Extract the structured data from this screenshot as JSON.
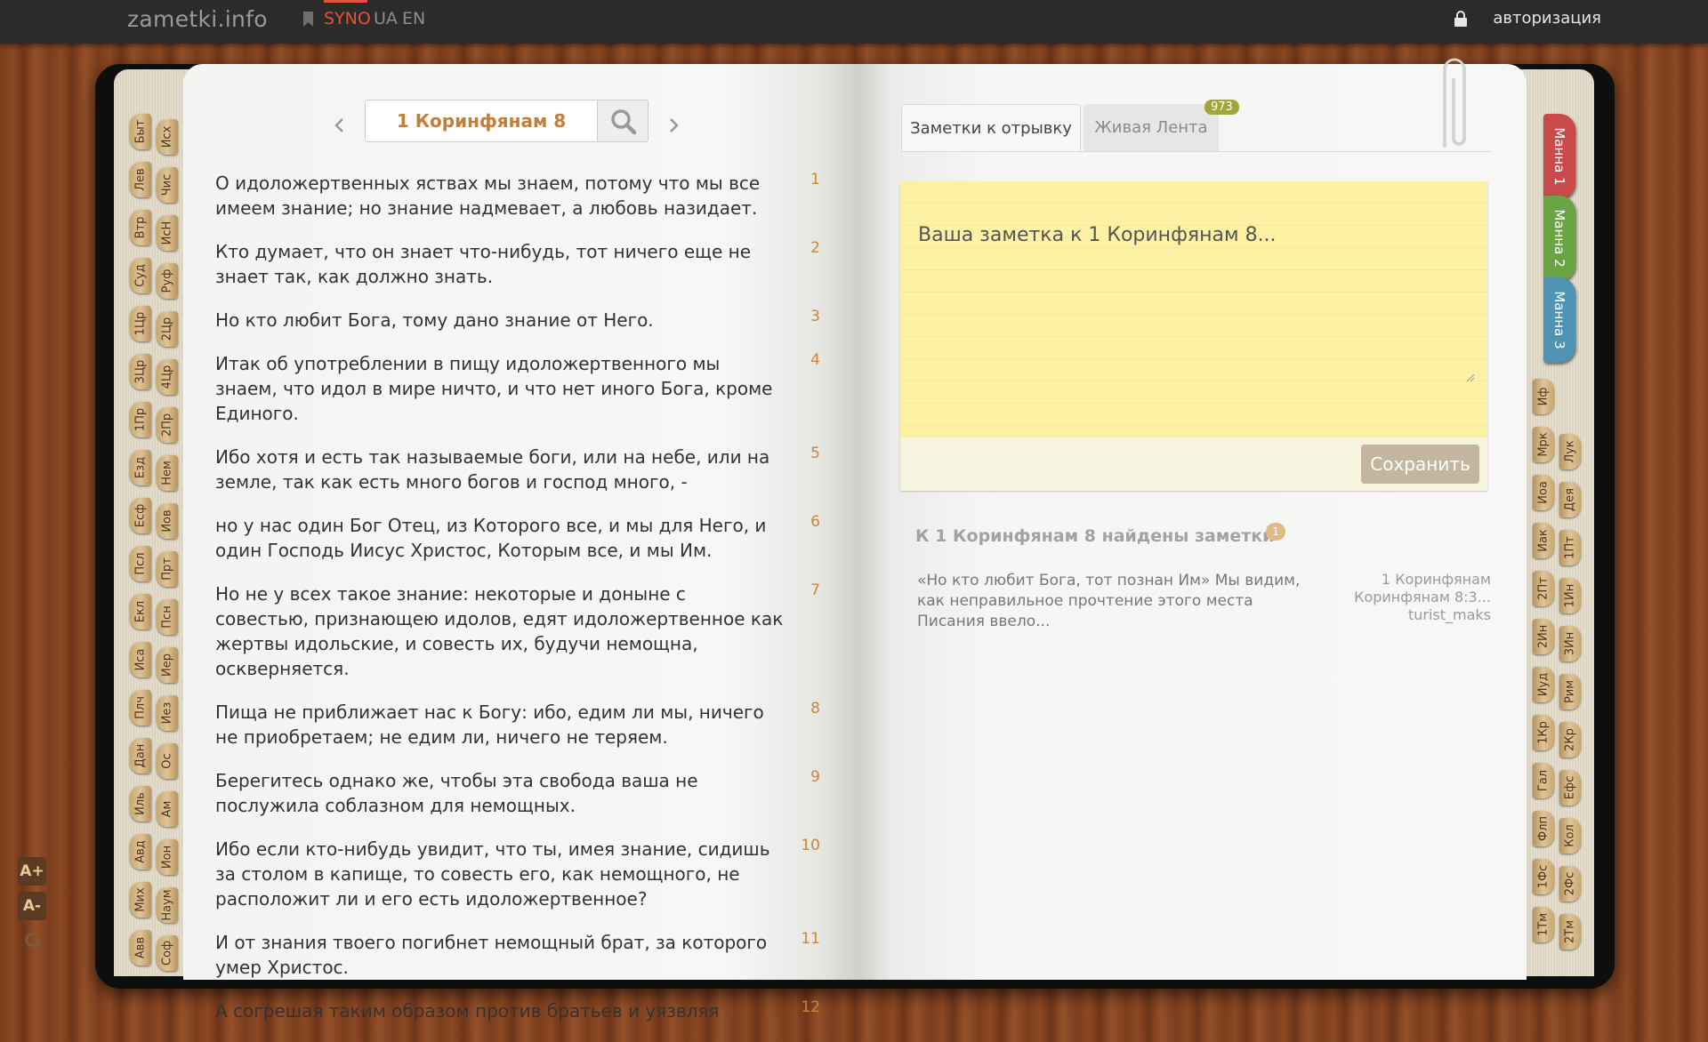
{
  "topbar": {
    "logo": "zametki.info",
    "languages": [
      "SYNO",
      "UA",
      "EN"
    ],
    "active_language": "SYNO",
    "auth_label": "авторизация",
    "accent_color": "#e3503c"
  },
  "left_tabs": {
    "col1": [
      "Быт",
      "Лев",
      "Втр",
      "Суд",
      "1Цр",
      "3Цр",
      "1Пр",
      "Езд",
      "Есф",
      "Псл",
      "Екл",
      "Иса",
      "Плч",
      "Дан",
      "Иль",
      "Авд",
      "Мих",
      "Авв"
    ],
    "col2": [
      "Исх",
      "Чис",
      "ИсН",
      "Руф",
      "2Цр",
      "4Цр",
      "2Пр",
      "Нем",
      "Иов",
      "Прт",
      "Псн",
      "Иер",
      "Иез",
      "Ос",
      "Ам",
      "Ион",
      "Наум",
      "Соф"
    ]
  },
  "right_tabs": {
    "manna": [
      "Манна 1",
      "Манна 2",
      "Манна 3"
    ],
    "col1": [
      "Иф",
      "Мрк",
      "Иоа",
      "Иак",
      "2Пт",
      "2Ин",
      "Иуд",
      "1Кр",
      "Гал",
      "Флп",
      "1Фс",
      "1Тм"
    ],
    "col2": [
      "Лук",
      "Дея",
      "1Пт",
      "1Ин",
      "3Ин",
      "Рим",
      "2Кр",
      "Ефс",
      "Кол",
      "2Фс",
      "2Тм"
    ]
  },
  "font_controls": [
    "A+",
    "A-"
  ],
  "search": {
    "query": "1 Коринфянам 8"
  },
  "verses": [
    {
      "n": "1",
      "text": "О идоложертвенных яствах мы знаем, потому что мы все имеем знание; но знание надмевает, а любовь назидает."
    },
    {
      "n": "2",
      "text": "Кто думает, что он знает что-нибудь, тот ничего еще не знает так, как должно знать."
    },
    {
      "n": "3",
      "text": "Но кто любит Бога, тому дано знание от Него."
    },
    {
      "n": "4",
      "text": "Итак об употреблении в пищу идоложертвенного мы знаем, что идол в мире ничто, и что нет иного Бога, кроме Единого."
    },
    {
      "n": "5",
      "text": "Ибо хотя и есть так называемые боги, или на небе, или на земле, так как есть много богов и господ много, -"
    },
    {
      "n": "6",
      "text": "но у нас один Бог Отец, из Которого все, и мы для Него, и один Господь Иисус Христос, Которым все, и мы Им."
    },
    {
      "n": "7",
      "text": "Но не у всех такое знание: некоторые и доныне с совестью, признающею идолов, едят идоложертвенное как жертвы идольские, и совесть их, будучи немощна, оскверняется."
    },
    {
      "n": "8",
      "text": "Пища не приближает нас к Богу: ибо, едим ли мы, ничего не приобретаем; не едим ли, ничего не теряем."
    },
    {
      "n": "9",
      "text": "Берегитесь однако же, чтобы эта свобода ваша не послужила соблазном для немощных."
    },
    {
      "n": "10",
      "text": "Ибо если кто-нибудь увидит, что ты, имея знание, сидишь за столом в капище, то совесть его, как немощного, не расположит ли и его есть идоложертвенное?"
    },
    {
      "n": "11",
      "text": "И от знания твоего погибнет немощный брат, за которого умер Христос."
    },
    {
      "n": "12",
      "text": "А согрешая таким образом против братьев и уязвляя"
    }
  ],
  "notes_panel": {
    "tabs": [
      "Заметки к отрывку",
      "Живая Лента"
    ],
    "live_count": "973",
    "placeholder": "Ваша заметка к 1 Коринфянам 8...",
    "save_label": "Сохранить",
    "found_title": "К 1 Коринфянам 8 найдены заметки",
    "found_count": "1",
    "note_excerpt": "«Но кто любит Бога, тот познан Им» Мы видим, как неправильное прочтение этого места Писания ввело...",
    "note_ref_line1": "1 Коринфянам",
    "note_ref_line2": "Коринфянам 8:3...",
    "note_author": "turist_maks"
  }
}
